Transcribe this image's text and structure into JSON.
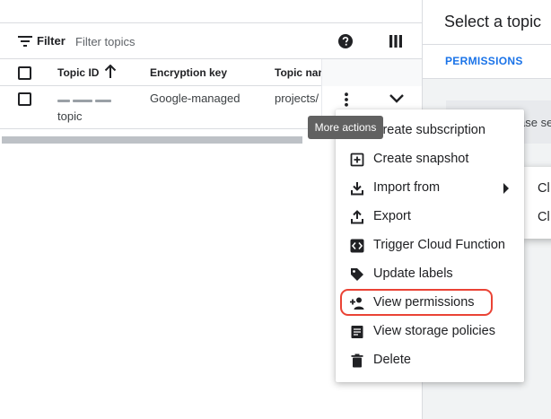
{
  "filter": {
    "label": "Filter",
    "placeholder": "Filter topics"
  },
  "table": {
    "columns": [
      "Topic ID",
      "Encryption key",
      "Topic nam"
    ],
    "rows": [
      {
        "topic_id_second_line": "topic",
        "encryption_key": "Google-managed",
        "topic_name": "projects/"
      }
    ]
  },
  "tooltip": {
    "text": "More actions"
  },
  "menu": {
    "items": [
      {
        "label": "Create subscription",
        "icon": "subscription-icon"
      },
      {
        "label": "Create snapshot",
        "icon": "add-box-icon"
      },
      {
        "label": "Import from",
        "icon": "download-icon",
        "has_submenu": true
      },
      {
        "label": "Export",
        "icon": "upload-icon"
      },
      {
        "label": "Trigger Cloud Function",
        "icon": "code-icon"
      },
      {
        "label": "Update labels",
        "icon": "label-tag-icon"
      },
      {
        "label": "View permissions",
        "icon": "person-add-icon",
        "highlighted": true
      },
      {
        "label": "View storage policies",
        "icon": "document-icon"
      },
      {
        "label": "Delete",
        "icon": "trash-icon"
      }
    ]
  },
  "submenu": {
    "items": [
      {
        "label": "Cl"
      },
      {
        "label": "Cl"
      }
    ]
  },
  "right_panel": {
    "title": "Select a topic",
    "tab": "PERMISSIONS",
    "notice_fragment": "ase se"
  },
  "colors": {
    "accent": "#1a73e8",
    "highlight": "#ea4335",
    "tooltip_bg": "#616161"
  }
}
